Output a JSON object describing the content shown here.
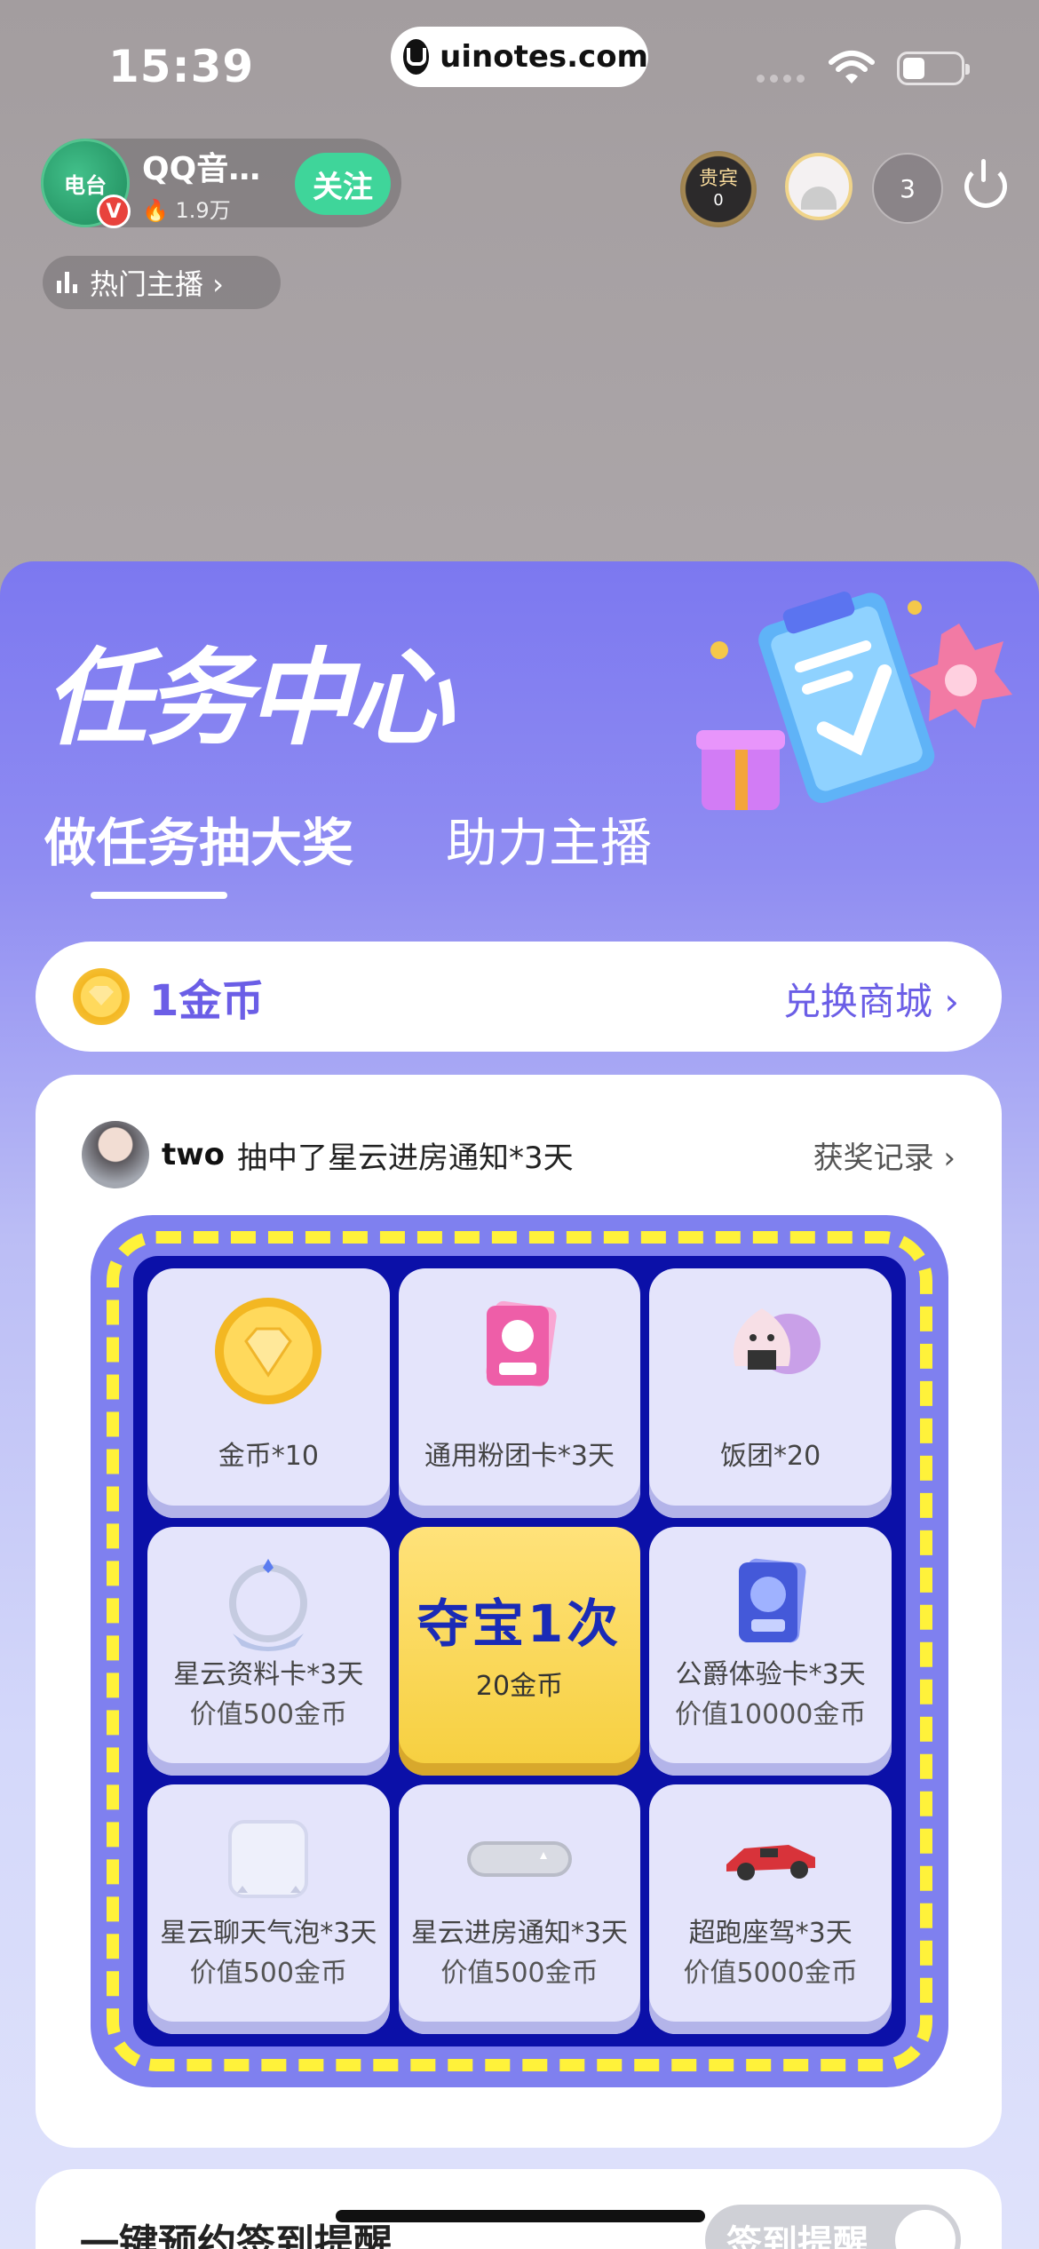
{
  "status_bar": {
    "time": "15:39",
    "url": "uinotes.com"
  },
  "anchor": {
    "avatar_text": "电台",
    "name": "QQ音…",
    "hot": "1.9万",
    "follow_label": "关注",
    "badge": "V"
  },
  "hot_anchors_label": "热门主播 ›",
  "top_right": {
    "vip_label": "贵宾",
    "vip_count": "0",
    "viewer_count": "3"
  },
  "panel": {
    "title": "任务中心",
    "tabs": [
      {
        "label": "做任务抽大奖"
      },
      {
        "label": "助力主播"
      }
    ],
    "coins": {
      "amount": "1金币",
      "shop_label": "兑换商城 ›"
    },
    "winner": {
      "name": "two",
      "text": "抽中了星云进房通知*3天",
      "records_label": "获奖记录 ›"
    },
    "grid": [
      {
        "name": "金币*10",
        "value": "",
        "icon": "gold-coin-icon"
      },
      {
        "name": "通用粉团卡*3天",
        "value": "",
        "icon": "fan-card-icon"
      },
      {
        "name": "饭团*20",
        "value": "",
        "icon": "rice-ball-icon"
      },
      {
        "name": "星云资料卡*3天",
        "value": "价值500金币",
        "icon": "profile-frame-icon"
      },
      {
        "name": "夺宝1次",
        "value": "20金币",
        "icon": ""
      },
      {
        "name": "公爵体验卡*3天",
        "value": "价值10000金币",
        "icon": "duke-card-icon"
      },
      {
        "name": "星云聊天气泡*3天",
        "value": "价值500金币",
        "icon": "chat-bubble-icon"
      },
      {
        "name": "星云进房通知*3天",
        "value": "价值500金币",
        "icon": "entry-notice-icon"
      },
      {
        "name": "超跑座驾*3天",
        "value": "价值5000金币",
        "icon": "sports-car-icon"
      }
    ],
    "bottom": {
      "title": "一键预约签到提醒",
      "button_label": "签到提醒"
    }
  },
  "colors": {
    "accent": "#6b5ee6",
    "follow": "#3fd59a",
    "grid_bg": "#0b10a8",
    "dash": "#fff23a"
  }
}
